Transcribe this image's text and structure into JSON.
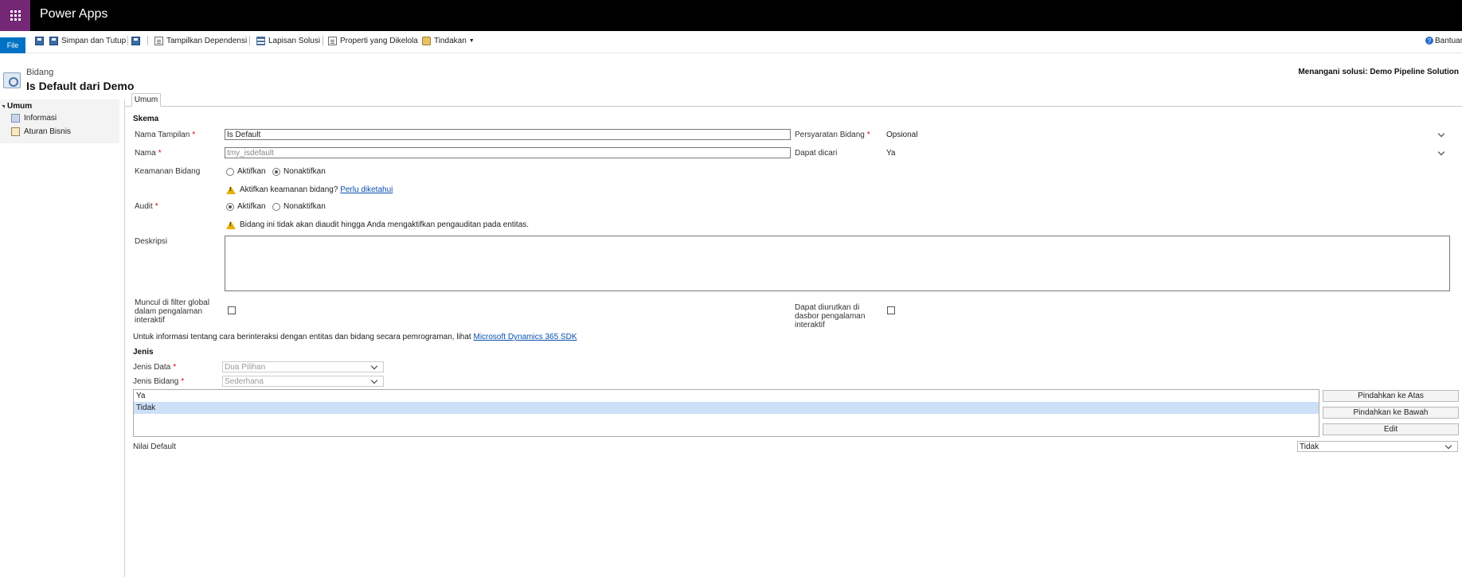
{
  "app": {
    "title": "Power Apps"
  },
  "ribbon": {
    "file": "File",
    "save_close": "Simpan dan Tutup",
    "show_dependencies": "Tampilkan Dependensi",
    "solution_layers": "Lapisan Solusi",
    "managed_properties": "Properti yang Dikelola",
    "actions": "Tindakan",
    "help": "Bantuan"
  },
  "header": {
    "breadcrumb": "Bidang",
    "title": "Is Default dari Demo",
    "solution": "Menangani solusi: Demo Pipeline Solution"
  },
  "nav": {
    "group": "Umum",
    "items": [
      "Informasi",
      "Aturan Bisnis"
    ]
  },
  "tabs": {
    "general": "Umum"
  },
  "schema": {
    "heading": "Skema",
    "display_name_label": "Nama Tampilan",
    "display_name_value": "Is Default",
    "name_label": "Nama",
    "name_value": "tmy_isdefault",
    "field_security_label": "Keamanan Bidang",
    "enable": "Aktifkan",
    "disable": "Nonaktifkan",
    "security_warning": "Aktifkan keamanan bidang?",
    "security_link": "Perlu diketahui",
    "audit_label": "Audit",
    "audit_enable": "Aktifkan",
    "audit_disable": "Nonaktifkan",
    "audit_warning": "Bidang ini tidak akan diaudit hingga Anda mengaktifkan pengauditan pada entitas.",
    "description_label": "Deskripsi",
    "requirement_label": "Persyaratan Bidang",
    "requirement_value": "Opsional",
    "searchable_label": "Dapat dicari",
    "searchable_value": "Ya",
    "global_filter_label": "Muncul di filter global dalam pengalaman interaktif",
    "sortable_label": "Dapat diurutkan di dasbor pengalaman interaktif",
    "sdk_text": "Untuk informasi tentang cara berinteraksi dengan entitas dan bidang secara pemrograman, lihat",
    "sdk_link": "Microsoft Dynamics 365 SDK"
  },
  "type": {
    "heading": "Jenis",
    "data_type_label": "Jenis Data",
    "data_type_value": "Dua Pilihan",
    "field_type_label": "Jenis Bidang",
    "field_type_value": "Sederhana",
    "options": [
      "Ya",
      "Tidak"
    ],
    "selected_option_index": 1,
    "move_up": "Pindahkan ke Atas",
    "move_down": "Pindahkan ke Bawah",
    "edit": "Edit",
    "default_value_label": "Nilai Default",
    "default_value": "Tidak"
  },
  "colors": {
    "topbar": "#000000",
    "waffle": "#742774",
    "file_button": "#0072c6",
    "selected_row": "#cce0f8",
    "required": "#dd0000"
  }
}
